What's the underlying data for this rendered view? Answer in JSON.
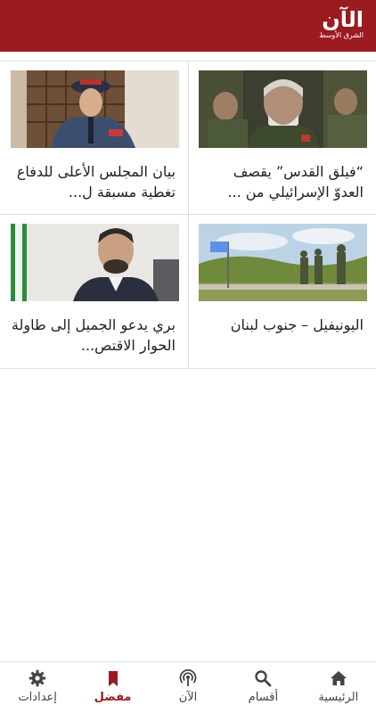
{
  "app": {
    "logo_main": "الآن",
    "logo_sub": "الشرق الأوسط",
    "brand_color": "#9b1b20"
  },
  "articles": [
    {
      "title": "“فيلق القدس” يقصف العدوّ الإسرائيلي من ...",
      "image": "general-portrait-photo"
    },
    {
      "title": "بيان المجلس الأعلى للدفاع تغطية مسبقة ل...",
      "image": "army-officer-photo"
    },
    {
      "title": "اليونيفيل – جنوب لبنان",
      "image": "peacekeepers-photo"
    },
    {
      "title": "بري يدعو الجميل إلى طاولة الحوار الاقتص...",
      "image": "politician-photo"
    }
  ],
  "tabs": [
    {
      "label": "الرئيسية",
      "icon": "home-icon",
      "active": false
    },
    {
      "label": "أقسام",
      "icon": "search-icon",
      "active": false
    },
    {
      "label": "الآن",
      "icon": "broadcast-icon",
      "active": false
    },
    {
      "label": "مفضل",
      "icon": "bookmark-icon",
      "active": true
    },
    {
      "label": "إعدادات",
      "icon": "gear-icon",
      "active": false
    }
  ]
}
